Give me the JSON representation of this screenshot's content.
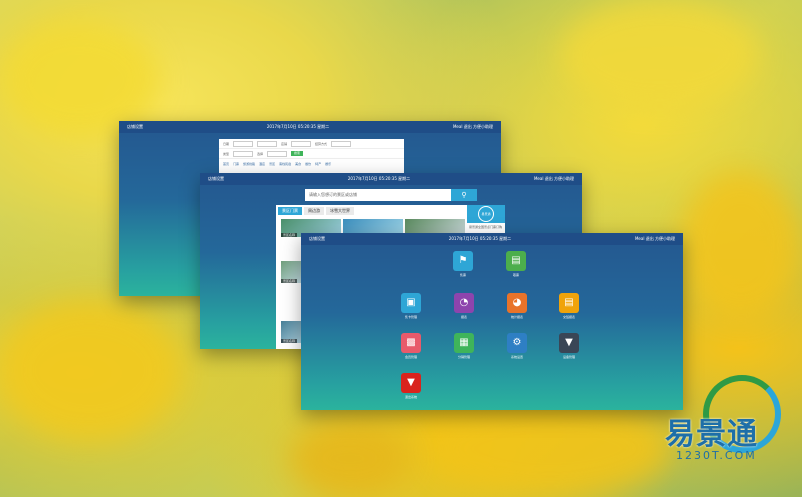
{
  "window1": {
    "header_title": "店铺设置",
    "header_datetime": "2017年7月10日 05:20:35 星期二",
    "header_user": "Meal 退出  方便小助理",
    "form": {
      "row1_label_a": "日期",
      "row1_label_b": "店铺",
      "row1_label_c": "结算方式",
      "row2_label_a": "类型",
      "row2_label_b": "选择",
      "search_button": "搜索"
    },
    "tabs": [
      "首页",
      "门票",
      "旅游线路",
      "酒店",
      "景区",
      "客栈民宿",
      "美食",
      "餐饮",
      "特产",
      "娱乐"
    ]
  },
  "window2": {
    "header_title": "店铺设置",
    "header_datetime": "2017年7月10日 05:20:35 星期二",
    "header_user": "Meal 退出  方便小助理",
    "search_placeholder": "请输入您想订的景区或店铺",
    "search_icon": "search-icon",
    "content_tabs": [
      "景区门票",
      "周边游",
      "冰雪大世界"
    ],
    "thumbnails": [
      "景区名称",
      "景区名称",
      "景区名称",
      "景区名称",
      "景区名称"
    ],
    "side_logo": "易景通",
    "side_text": "易景通全国景点门票订购"
  },
  "window3": {
    "header_title": "店铺设置",
    "header_datetime": "2017年7月10日 05:20:35 星期二",
    "header_user": "Meal 退出  方便小助理",
    "apps": [
      {
        "label": "售票",
        "icon": "tag-icon",
        "color": "#2ea6d6"
      },
      {
        "label": "取票",
        "icon": "printer-icon",
        "color": "#4cae4c"
      },
      {
        "label": "售卡管理",
        "icon": "card-icon",
        "color": "#2ea6d6"
      },
      {
        "label": "报表",
        "icon": "pie-chart-icon",
        "color": "#8e44ad"
      },
      {
        "label": "统计报表",
        "icon": "pie-chart-icon",
        "color": "#e8732a"
      },
      {
        "label": "交班报表",
        "icon": "report-icon",
        "color": "#f0a30a"
      },
      {
        "label": "会员管理",
        "icon": "member-icon",
        "color": "#e85a6b"
      },
      {
        "label": "分销管理",
        "icon": "distribution-icon",
        "color": "#3fb45a"
      },
      {
        "label": "系统设置",
        "icon": "gear-icon",
        "color": "#2e7fc4"
      },
      {
        "label": "设备管理",
        "icon": "cocktail-icon",
        "color": "#3a4656"
      },
      {
        "label": "退出系统",
        "icon": "cocktail-icon",
        "color": "#d9231d"
      }
    ]
  },
  "logo": {
    "chinese": "易景通",
    "url": "1230T.COM"
  },
  "colors": {
    "window_top": "#24578f",
    "window_bottom": "#2bb39d",
    "accent_blue": "#2ea6d6",
    "logo_green": "#2f9a45",
    "logo_blue": "#1e6fa8"
  }
}
